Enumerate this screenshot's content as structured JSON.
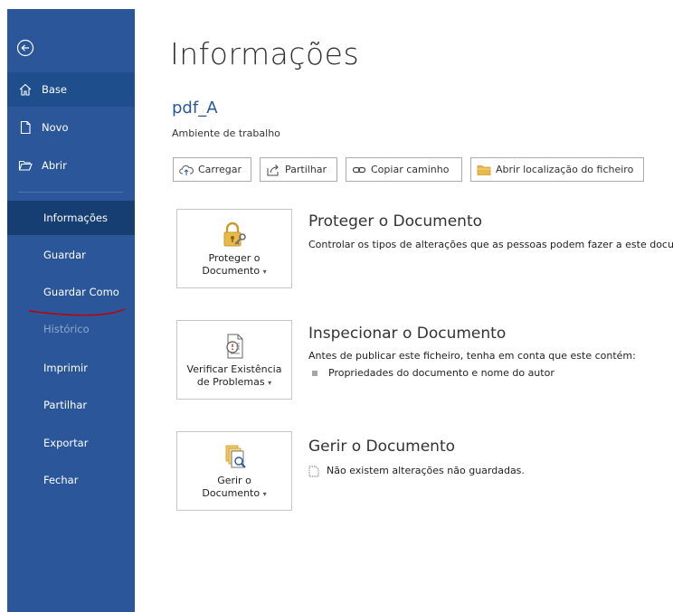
{
  "sidebar": {
    "back_label": "",
    "items": [
      {
        "label": "Base"
      },
      {
        "label": "Novo"
      },
      {
        "label": "Abrir"
      },
      {
        "label": "Informações"
      },
      {
        "label": "Guardar"
      },
      {
        "label": "Guardar Como"
      },
      {
        "label": "Histórico"
      },
      {
        "label": "Imprimir"
      },
      {
        "label": "Partilhar"
      },
      {
        "label": "Exportar"
      },
      {
        "label": "Fechar"
      }
    ]
  },
  "main": {
    "title": "Informações",
    "doc_name": "pdf_A",
    "doc_location": "Ambiente de trabalho",
    "toolbar": [
      {
        "label": "Carregar",
        "icon": "upload-cloud-icon"
      },
      {
        "label": "Partilhar",
        "icon": "share-icon"
      },
      {
        "label": "Copiar caminho",
        "icon": "link-icon"
      },
      {
        "label": "Abrir localização do ficheiro",
        "icon": "folder-icon"
      }
    ],
    "sections": [
      {
        "button_line1": "Proteger o",
        "button_line2": "Documento",
        "title": "Proteger o Documento",
        "description": "Controlar os tipos de alterações que as pessoas podem fazer a este docum"
      },
      {
        "button_line1": "Verificar Existência",
        "button_line2": "de Problemas",
        "title": "Inspecionar o Documento",
        "description": "Antes de publicar este ficheiro, tenha em conta que este contém:",
        "bullet": "Propriedades do documento e nome do autor"
      },
      {
        "button_line1": "Gerir o",
        "button_line2": "Documento",
        "title": "Gerir o Documento",
        "description": "Não existem alterações não guardadas."
      }
    ]
  },
  "colors": {
    "sidebar_bg": "#2b579a",
    "sidebar_selected": "#163e73",
    "accent": "#2b579a",
    "annotation": "#c00000"
  }
}
